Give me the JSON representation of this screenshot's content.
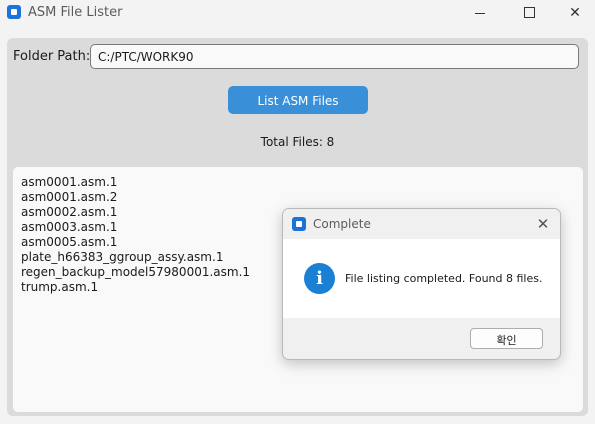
{
  "window": {
    "title": "ASM File Lister",
    "minimize_label": "—",
    "close_label": "✕"
  },
  "folder": {
    "label": "Folder Path:",
    "value": "C:/PTC/WORK90"
  },
  "actions": {
    "list_button_label": "List ASM Files"
  },
  "summary": {
    "total_files_text": "Total Files: 8"
  },
  "files": [
    "asm0001.asm.1",
    "asm0001.asm.2",
    "asm0002.asm.1",
    "asm0003.asm.1",
    "asm0005.asm.1",
    "plate_h66383_ggroup_assy.asm.1",
    "regen_backup_model57980001.asm.1",
    "trump.asm.1"
  ],
  "dialog": {
    "title": "Complete",
    "close_label": "✕",
    "icon": "info-icon",
    "icon_glyph": "i",
    "message": "File listing completed. Found 8 files.",
    "ok_label": "확인"
  },
  "colors": {
    "accent": "#3a8fd9",
    "info": "#1b7fd4"
  }
}
